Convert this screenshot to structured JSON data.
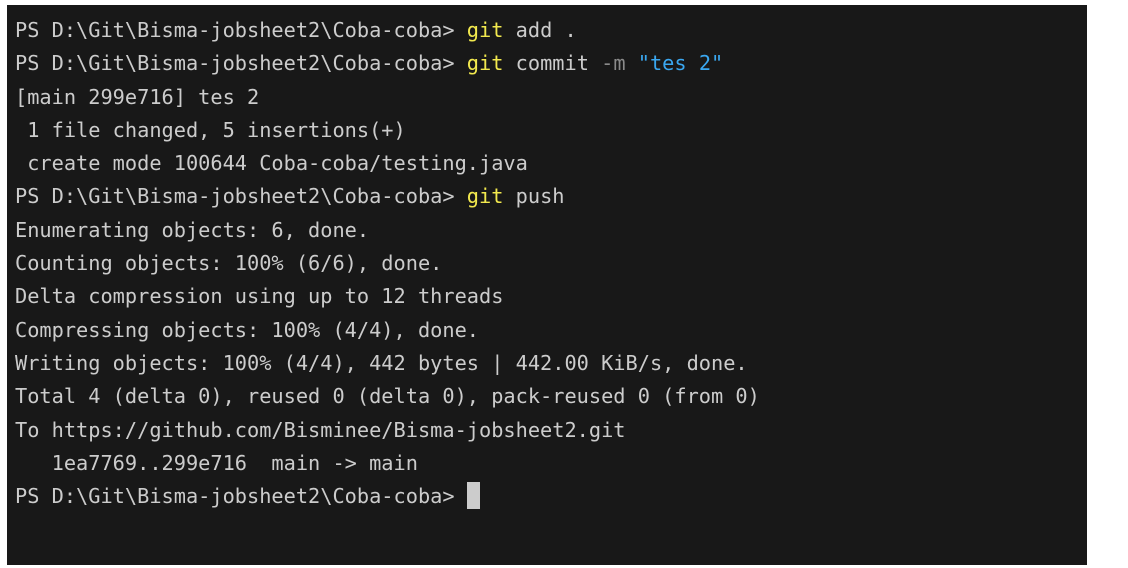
{
  "terminal": {
    "prompt": "PS D:\\Git\\Bisma-jobsheet2\\Coba-coba> ",
    "lines": [
      {
        "type": "command",
        "cmd": "git",
        "rest": " add ."
      },
      {
        "type": "command-commit",
        "cmd": "git",
        "rest": " commit ",
        "flag": "-m",
        "str": "\"tes 2\""
      },
      {
        "type": "output",
        "text": "[main 299e716] tes 2"
      },
      {
        "type": "output",
        "text": " 1 file changed, 5 insertions(+)"
      },
      {
        "type": "output",
        "text": " create mode 100644 Coba-coba/testing.java"
      },
      {
        "type": "command",
        "cmd": "git",
        "rest": " push"
      },
      {
        "type": "output",
        "text": "Enumerating objects: 6, done."
      },
      {
        "type": "output",
        "text": "Counting objects: 100% (6/6), done."
      },
      {
        "type": "output",
        "text": "Delta compression using up to 12 threads"
      },
      {
        "type": "output",
        "text": "Compressing objects: 100% (4/4), done."
      },
      {
        "type": "output",
        "text": "Writing objects: 100% (4/4), 442 bytes | 442.00 KiB/s, done."
      },
      {
        "type": "output",
        "text": "Total 4 (delta 0), reused 0 (delta 0), pack-reused 0 (from 0)"
      },
      {
        "type": "output",
        "text": "To https://github.com/Bisminee/Bisma-jobsheet2.git"
      },
      {
        "type": "output",
        "text": "   1ea7769..299e716  main -> main"
      },
      {
        "type": "prompt-only"
      }
    ],
    "colors": {
      "background": "#181818",
      "text": "#cccccc",
      "command": "#f2e94e",
      "flag": "#8a8a8a",
      "string": "#3aa7f0"
    }
  }
}
